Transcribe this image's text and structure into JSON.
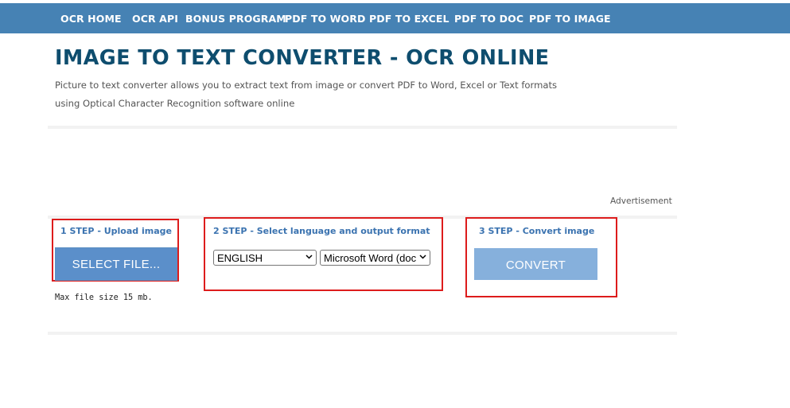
{
  "nav": {
    "items": [
      "OCR HOME",
      "OCR API",
      "BONUS PROGRAM",
      "PDF TO WORD",
      "PDF TO EXCEL",
      "PDF TO DOC",
      "PDF TO IMAGE"
    ]
  },
  "header": {
    "title": "IMAGE TO TEXT CONVERTER - OCR ONLINE",
    "description_line1": "Picture to text converter allows you to extract text from image or convert PDF to Word, Excel or Text formats",
    "description_line2": "using Optical Character Recognition software online"
  },
  "ad": {
    "label": "Advertisement"
  },
  "steps": {
    "step1": {
      "title": "1 STEP - Upload image",
      "button_label": "SELECT FILE..."
    },
    "step2": {
      "title": "2 STEP - Select language and output format",
      "language_value": "ENGLISH",
      "format_value": "Microsoft Word (doc"
    },
    "step3": {
      "title": "3 STEP - Convert image",
      "button_label": "CONVERT"
    }
  },
  "max_file_size": "Max file size 15 mb.",
  "colors": {
    "nav_bg": "#4682b4",
    "title": "#0e4d6e",
    "step_title": "#3b73b0",
    "highlight_border": "#dd1c1c",
    "select_button_bg": "#5b8fca",
    "convert_button_bg": "#86b0dc"
  },
  "icons": {
    "dropdown": "chevron-down-icon"
  }
}
